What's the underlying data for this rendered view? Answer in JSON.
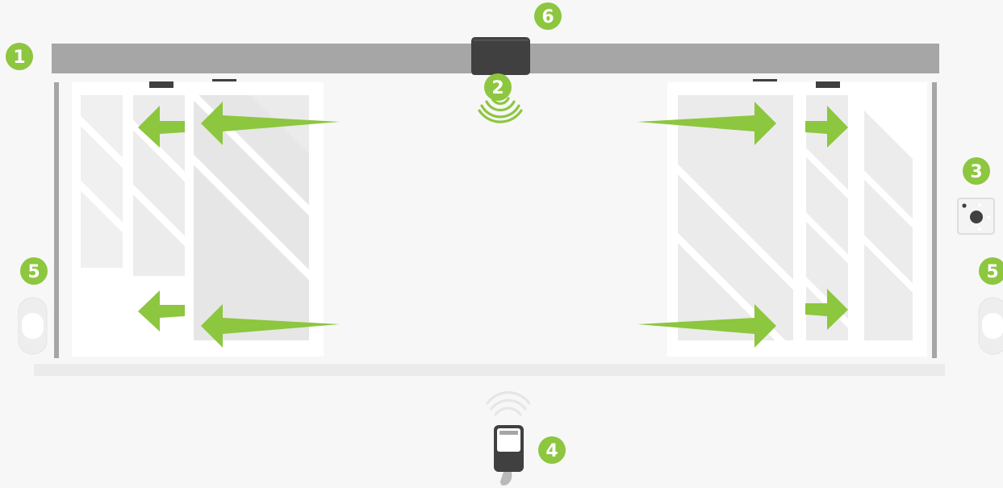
{
  "markers": {
    "header_track": "1",
    "motion_sensor": "2",
    "wall_button": "3",
    "remote": "4",
    "photocell_left": "5",
    "photocell_right": "5",
    "drive_unit": "6"
  },
  "colors": {
    "background": "#f7f7f7",
    "marker": "#8dc63f",
    "arrow": "#8dc63f",
    "track": "#a6a6a6",
    "dark_device": "#404040",
    "glass": "#ffffff",
    "glass_shade": "#ececec"
  },
  "icons": {
    "motor": "drive-unit-icon",
    "sensor_waves": "wireless-signal-icon",
    "button": "push-button-icon",
    "remote": "remote-control-icon",
    "photocell": "photocell-icon"
  }
}
